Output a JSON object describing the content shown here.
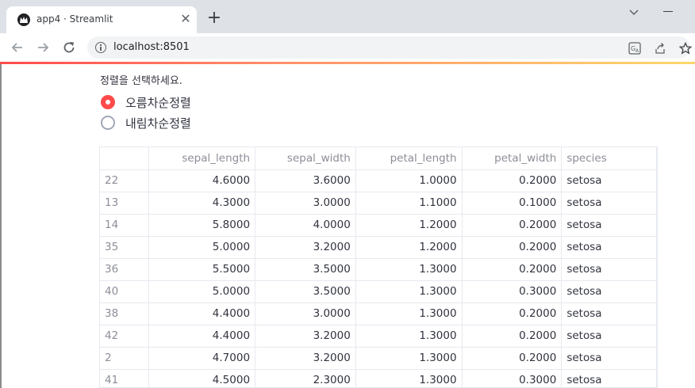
{
  "browser": {
    "tab_title": "app4 · Streamlit",
    "new_tab_symbol": "+",
    "close_symbol": "✕",
    "url": "localhost:8501"
  },
  "app": {
    "radio_label": "정렬을 선택하세요.",
    "options": [
      {
        "label": "오름차순정렬",
        "selected": true
      },
      {
        "label": "내림차순정렬",
        "selected": false
      }
    ],
    "accent_color": "#ff4b4b"
  },
  "table": {
    "columns": [
      "",
      "sepal_length",
      "sepal_width",
      "petal_length",
      "petal_width",
      "species"
    ],
    "rows": [
      [
        "22",
        "4.6000",
        "3.6000",
        "1.0000",
        "0.2000",
        "setosa"
      ],
      [
        "13",
        "4.3000",
        "3.0000",
        "1.1000",
        "0.1000",
        "setosa"
      ],
      [
        "14",
        "5.8000",
        "4.0000",
        "1.2000",
        "0.2000",
        "setosa"
      ],
      [
        "35",
        "5.0000",
        "3.2000",
        "1.2000",
        "0.2000",
        "setosa"
      ],
      [
        "36",
        "5.5000",
        "3.5000",
        "1.3000",
        "0.2000",
        "setosa"
      ],
      [
        "40",
        "5.0000",
        "3.5000",
        "1.3000",
        "0.3000",
        "setosa"
      ],
      [
        "38",
        "4.4000",
        "3.0000",
        "1.3000",
        "0.2000",
        "setosa"
      ],
      [
        "42",
        "4.4000",
        "3.2000",
        "1.3000",
        "0.2000",
        "setosa"
      ],
      [
        "2",
        "4.7000",
        "3.2000",
        "1.3000",
        "0.2000",
        "setosa"
      ],
      [
        "41",
        "4.5000",
        "2.3000",
        "1.3000",
        "0.3000",
        "setosa"
      ]
    ]
  }
}
